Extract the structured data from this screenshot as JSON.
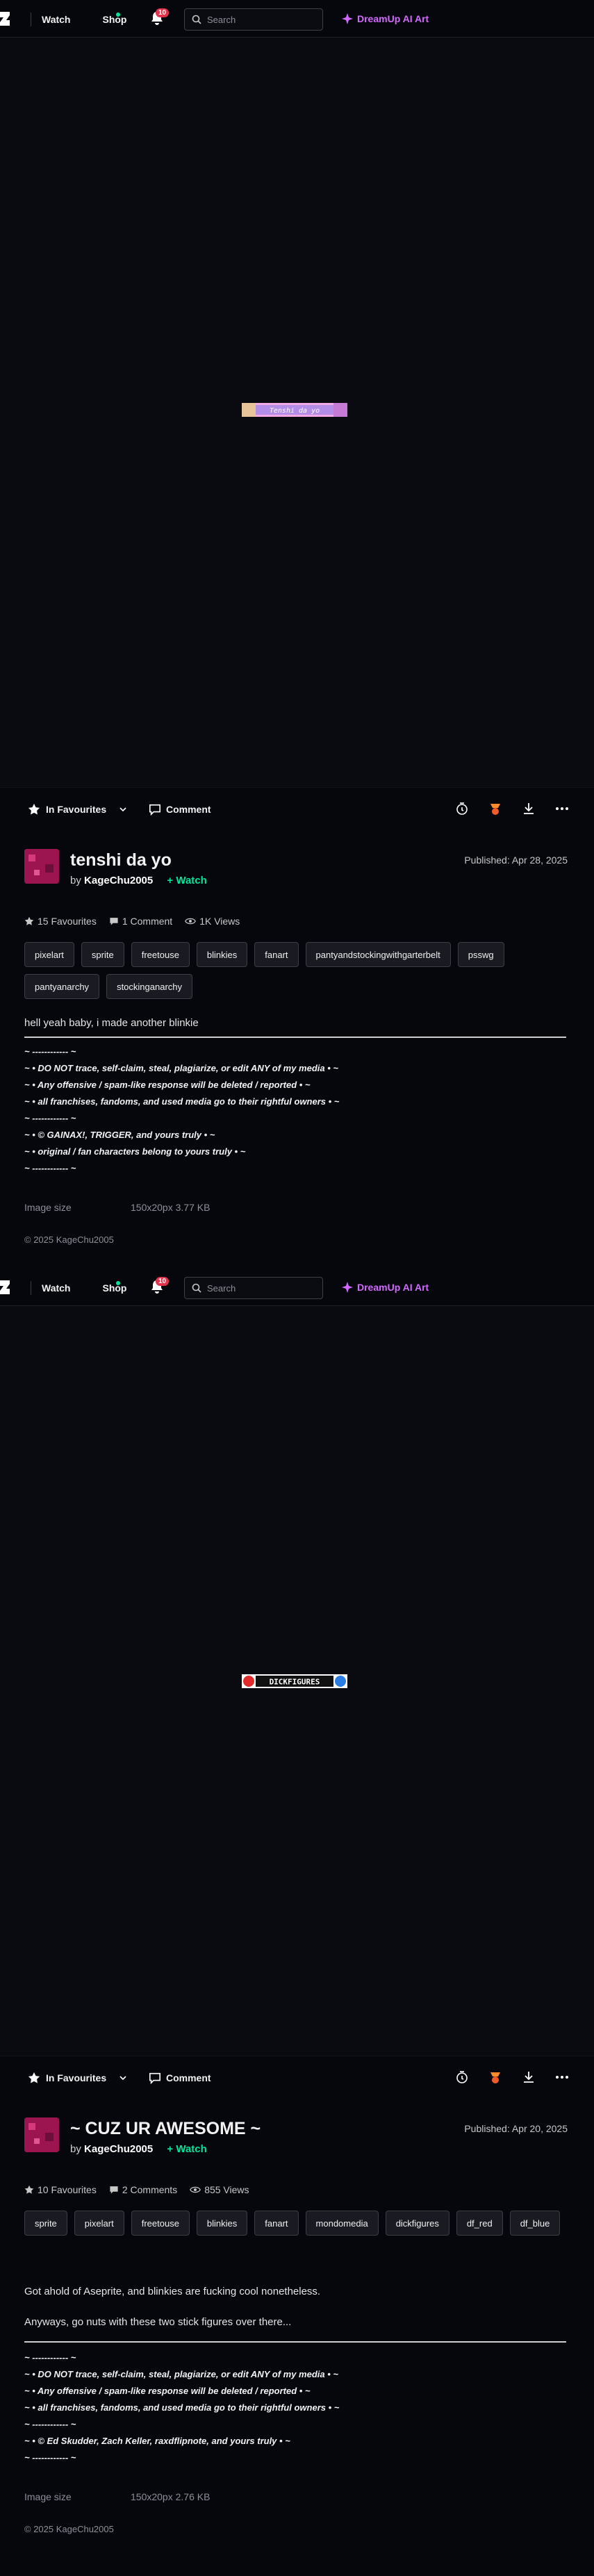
{
  "topbar": {
    "nav": [
      "Watch",
      "Shop"
    ],
    "notifications": "10",
    "search_placeholder": "Search",
    "dreamup": "DreamUp AI Art"
  },
  "deviations": [
    {
      "art_alt": "blinkie",
      "art_text": "Tenshi da yo",
      "fav_label": "In Favourites",
      "comment_label": "Comment",
      "title": "tenshi da yo",
      "by_prefix": "by",
      "author": "KageChu2005",
      "watch_label": "Watch",
      "published": "Published: Apr 28, 2025",
      "favourites": "15 Favourites",
      "comments": "1 Comment",
      "views": "1K Views",
      "tags": [
        "pixelart",
        "sprite",
        "freetouse",
        "blinkies",
        "fanart",
        "pantyandstockingwithgarterbelt",
        "psswg",
        "pantyanarchy",
        "stockinganarchy"
      ],
      "description": [
        "hell yeah baby, i made another blinkie"
      ],
      "rules": [
        "~ ------------ ~",
        "~ • DO NOT trace, self-claim, steal, plagiarize, or edit ANY of my media • ~",
        "~ • Any offensive / spam-like response will be deleted / reported • ~",
        "~ • all franchises, fandoms, and used media go to their rightful owners • ~",
        "~ ------------ ~",
        "~ • © GAINAX!, TRIGGER, and yours truly • ~",
        "~ • original / fan characters belong to yours truly • ~",
        "~ ------------ ~"
      ],
      "image_size_label": "Image size",
      "image_size": "150x20px 3.77 KB",
      "copyright": "© 2025 KageChu2005"
    },
    {
      "art_alt": "blinkie",
      "art_text": "DICKFIGURES",
      "fav_label": "In Favourites",
      "comment_label": "Comment",
      "title": "~ CUZ UR AWESOME ~",
      "by_prefix": "by",
      "author": "KageChu2005",
      "watch_label": "Watch",
      "published": "Published: Apr 20, 2025",
      "favourites": "10 Favourites",
      "comments": "2 Comments",
      "views": "855 Views",
      "tags": [
        "sprite",
        "pixelart",
        "freetouse",
        "blinkies",
        "fanart",
        "mondomedia",
        "dickfigures",
        "df_red",
        "df_blue"
      ],
      "description": [
        "Got ahold of Aseprite, and blinkies are fucking cool nonetheless.",
        "Anyways, go nuts with these two stick figures over there..."
      ],
      "rules": [
        "~ ------------ ~",
        "~ • DO NOT trace, self-claim, steal, plagiarize, or edit ANY of my media • ~",
        "~ • Any offensive / spam-like response will be deleted / reported • ~",
        "~ • all franchises, fandoms, and used media go to their rightful owners • ~",
        "~ ------------ ~",
        "~ • © Ed Skudder, Zach Keller, raxdflipnote, and yours truly • ~",
        "~ ------------ ~"
      ],
      "image_size_label": "Image size",
      "image_size": "150x20px 2.76 KB",
      "copyright": "© 2025 KageChu2005"
    }
  ],
  "colors": {
    "accent_green": "#00e59b",
    "dreamup_purple": "#d269ff",
    "badge_red": "#e0324b",
    "bg": "#06070d"
  }
}
